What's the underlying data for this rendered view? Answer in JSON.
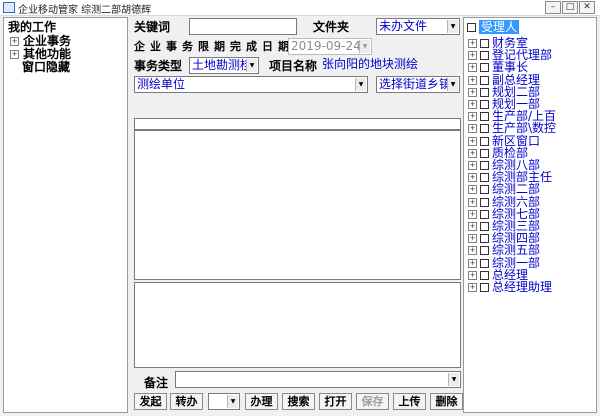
{
  "window": {
    "title": "企业移动管家  综测二部胡德辉"
  },
  "left_tree": {
    "root": "我的工作",
    "items": [
      {
        "label": "企业事务",
        "expandable": true
      },
      {
        "label": "其他功能",
        "expandable": true
      },
      {
        "label": "窗口隐藏",
        "expandable": false
      }
    ]
  },
  "form": {
    "keyword_label": "关键词",
    "keyword_value": "",
    "folder_label": "文件夹",
    "folder_value": "未办文件",
    "deadline_label": "企业事务限期完成日期",
    "deadline_value": "2019-09-24",
    "task_type_label": "事务类型",
    "task_type_value": "土地勘测桂",
    "project_name_label": "项目名称",
    "project_name_value": "张向阳的地块测绘",
    "unit_value": "测绘单位",
    "street_value": "选择街道乡镇",
    "remark_label": "备注",
    "remark_value": "",
    "forward_select_value": ""
  },
  "buttons": {
    "initiate": "发起",
    "forward": "转办",
    "handle": "办理",
    "search": "搜索",
    "open": "打开",
    "save": "保存",
    "upload": "上传",
    "delete": "删除"
  },
  "recipients": {
    "header": "受理人",
    "items": [
      "财务室",
      "登记代理部",
      "董事长",
      "副总经理",
      "规划二部",
      "规划一部",
      "生产部/上百",
      "生产部\\数控",
      "新区窗口",
      "质检部",
      "综测八部",
      "综测部主任",
      "综测二部",
      "综测六部",
      "综测七部",
      "综测三部",
      "综测四部",
      "综测五部",
      "综测一部",
      "总经理",
      "总经理助理"
    ]
  },
  "colors": {
    "highlight": "#3399ff",
    "blue_text": "#0000cc"
  }
}
